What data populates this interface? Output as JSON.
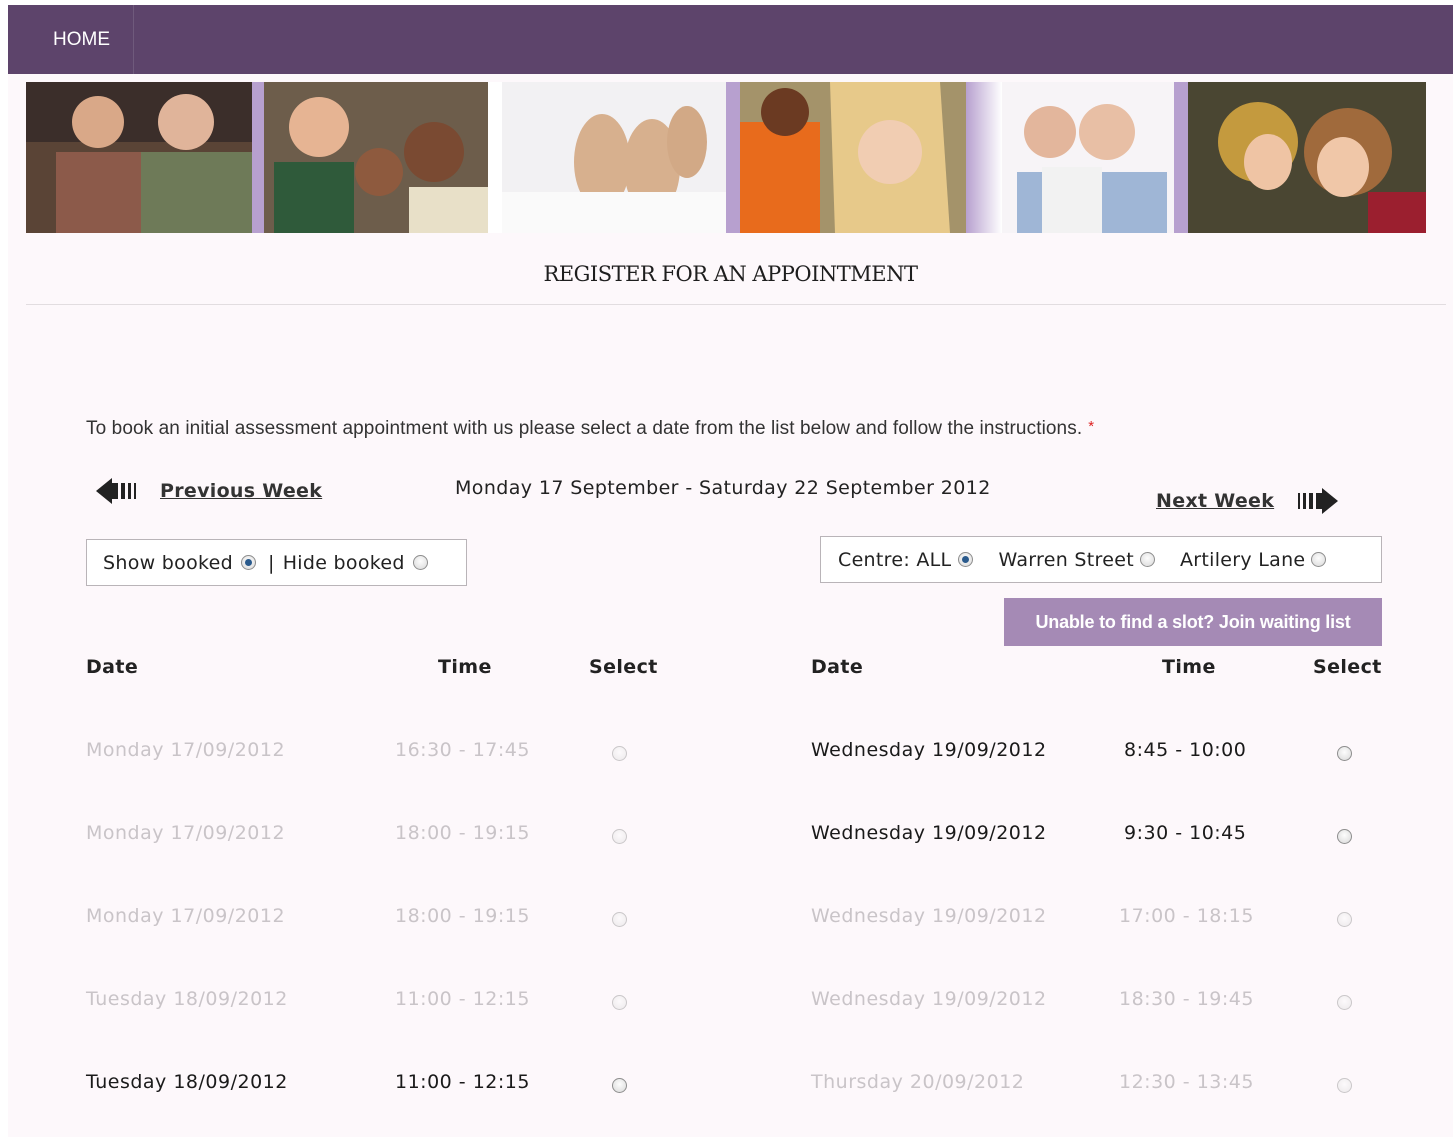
{
  "nav": {
    "home_label": "HOME"
  },
  "page_title": "REGISTER FOR AN APPOINTMENT",
  "instructions": "To book an initial assessment appointment with us please select a date from the list below and follow the instructions.",
  "required_marker": "*",
  "week_nav": {
    "previous_label": "Previous Week",
    "range": "Monday 17 September - Saturday 22 September 2012",
    "next_label": "Next Week"
  },
  "booked_filter": {
    "show_label": "Show booked",
    "separator": "|",
    "hide_label": "Hide booked",
    "selected": "show"
  },
  "centre_filter": {
    "all_label": "Centre: ALL",
    "warren_label": "Warren Street",
    "artillery_label": "Artilery Lane",
    "selected": "all"
  },
  "waitlist_button": "Unable to find a slot? Join waiting list",
  "table_headers": {
    "date": "Date",
    "time": "Time",
    "select": "Select"
  },
  "left_slots": [
    {
      "date": "Monday 17/09/2012",
      "time": "16:30 - 17:45",
      "booked": true
    },
    {
      "date": "Monday 17/09/2012",
      "time": "18:00 - 19:15",
      "booked": true
    },
    {
      "date": "Monday 17/09/2012",
      "time": "18:00 - 19:15",
      "booked": true
    },
    {
      "date": "Tuesday 18/09/2012",
      "time": "11:00 - 12:15",
      "booked": true
    },
    {
      "date": "Tuesday 18/09/2012",
      "time": "11:00 - 12:15",
      "booked": false
    }
  ],
  "right_slots": [
    {
      "date": "Wednesday 19/09/2012",
      "time": "8:45 - 10:00",
      "booked": false
    },
    {
      "date": "Wednesday 19/09/2012",
      "time": "9:30 - 10:45",
      "booked": false
    },
    {
      "date": "Wednesday 19/09/2012",
      "time": "17:00 - 18:15",
      "booked": true
    },
    {
      "date": "Wednesday 19/09/2012",
      "time": "18:30 - 19:45",
      "booked": true
    },
    {
      "date": "Thursday 20/09/2012",
      "time": "12:30 - 13:45",
      "booked": true
    }
  ],
  "colors": {
    "nav_bg": "#5d446b",
    "accent_button": "#a58ab5",
    "banner_strip": "#b7a0cf",
    "booked_text": "#c9c4c8"
  }
}
